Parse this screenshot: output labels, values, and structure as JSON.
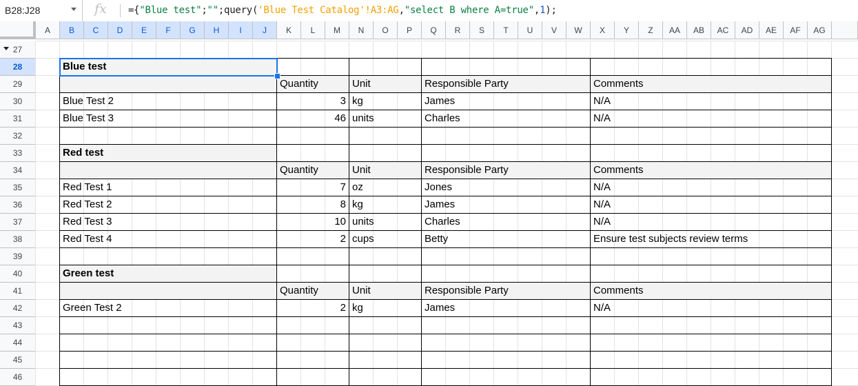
{
  "name_box": {
    "value": "B28:J28"
  },
  "formula_bar": {
    "fx_label": "fx",
    "tokens": [
      {
        "t": "={",
        "c": ""
      },
      {
        "t": "\"Blue test\"",
        "c": "str"
      },
      {
        "t": ";",
        "c": ""
      },
      {
        "t": "\"\"",
        "c": "str"
      },
      {
        "t": ";query(",
        "c": ""
      },
      {
        "t": "'Blue Test Catalog'!A3:AG",
        "c": "ref"
      },
      {
        "t": ",",
        "c": ""
      },
      {
        "t": "\"select B where A=true\"",
        "c": "str"
      },
      {
        "t": ",",
        "c": ""
      },
      {
        "t": "1",
        "c": "num"
      },
      {
        "t": ");",
        "c": ""
      }
    ]
  },
  "columns": [
    "A",
    "B",
    "C",
    "D",
    "E",
    "F",
    "G",
    "H",
    "I",
    "J",
    "K",
    "L",
    "M",
    "N",
    "O",
    "P",
    "Q",
    "R",
    "S",
    "T",
    "U",
    "V",
    "W",
    "X",
    "Y",
    "Z",
    "AA",
    "AB",
    "AC",
    "AD",
    "AE",
    "AF",
    "AG"
  ],
  "selected_columns": [
    "B",
    "C",
    "D",
    "E",
    "F",
    "G",
    "H",
    "I",
    "J"
  ],
  "rows": [
    "27",
    "28",
    "29",
    "30",
    "31",
    "32",
    "33",
    "34",
    "35",
    "36",
    "37",
    "38",
    "39",
    "40",
    "41",
    "42",
    "43",
    "44",
    "45",
    "46"
  ],
  "selected_row": "28",
  "table_rows": [
    {
      "row": "28",
      "name": "Blue test",
      "type": "section"
    },
    {
      "row": "29",
      "type": "header",
      "qty": "Quantity",
      "unit": "Unit",
      "party": "Responsible Party",
      "comments": "Comments"
    },
    {
      "row": "30",
      "type": "item",
      "name": "Blue Test 2",
      "qty": "3",
      "unit": "kg",
      "party": "James",
      "comments": "N/A"
    },
    {
      "row": "31",
      "type": "item",
      "name": "Blue Test 3",
      "qty": "46",
      "unit": "units",
      "party": "Charles",
      "comments": "N/A"
    },
    {
      "row": "32",
      "type": "blank"
    },
    {
      "row": "33",
      "name": "Red test",
      "type": "section"
    },
    {
      "row": "34",
      "type": "header",
      "qty": "Quantity",
      "unit": "Unit",
      "party": "Responsible Party",
      "comments": "Comments"
    },
    {
      "row": "35",
      "type": "item",
      "name": "Red Test 1",
      "qty": "7",
      "unit": "oz",
      "party": "Jones",
      "comments": "N/A"
    },
    {
      "row": "36",
      "type": "item",
      "name": "Red Test 2",
      "qty": "8",
      "unit": "kg",
      "party": "James",
      "comments": "N/A"
    },
    {
      "row": "37",
      "type": "item",
      "name": "Red Test 3",
      "qty": "10",
      "unit": "units",
      "party": "Charles",
      "comments": "N/A"
    },
    {
      "row": "38",
      "type": "item",
      "name": "Red Test 4",
      "qty": "2",
      "unit": "cups",
      "party": "Betty",
      "comments": "Ensure test subjects review terms"
    },
    {
      "row": "39",
      "type": "blank"
    },
    {
      "row": "40",
      "name": "Green test",
      "type": "section"
    },
    {
      "row": "41",
      "type": "header",
      "qty": "Quantity",
      "unit": "Unit",
      "party": "Responsible Party",
      "comments": "Comments"
    },
    {
      "row": "42",
      "type": "item",
      "name": "Green Test 2",
      "qty": "2",
      "unit": "kg",
      "party": "James",
      "comments": "N/A"
    },
    {
      "row": "43",
      "type": "blank"
    },
    {
      "row": "44",
      "type": "blank"
    },
    {
      "row": "45",
      "type": "blank"
    },
    {
      "row": "46",
      "type": "blank"
    }
  ]
}
